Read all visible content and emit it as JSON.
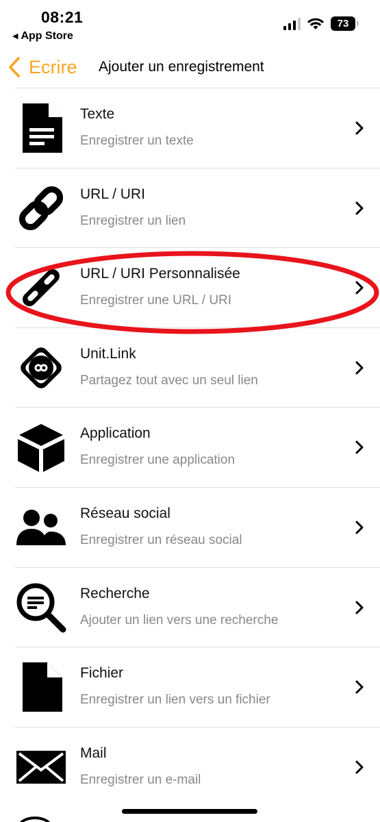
{
  "status_bar": {
    "time": "08:21",
    "back_app": "App Store",
    "battery": "73"
  },
  "nav": {
    "back_label": "Ecrire",
    "title": "Ajouter un enregistrement",
    "accent_color": "#f5a623"
  },
  "items": [
    {
      "icon": "document-icon",
      "title": "Texte",
      "subtitle": "Enregistrer un texte"
    },
    {
      "icon": "link-icon",
      "title": "URL / URI",
      "subtitle": "Enregistrer un lien"
    },
    {
      "icon": "custom-link-icon",
      "title": "URL / URI Personnalisée",
      "subtitle": "Enregistrer une URL / URI"
    },
    {
      "icon": "unitlink-icon",
      "title": "Unit.Link",
      "subtitle": "Partagez tout avec un seul lien"
    },
    {
      "icon": "cube-icon",
      "title": "Application",
      "subtitle": "Enregistrer une application"
    },
    {
      "icon": "people-icon",
      "title": "Réseau social",
      "subtitle": "Enregistrer un réseau social"
    },
    {
      "icon": "search-icon",
      "title": "Recherche",
      "subtitle": "Ajouter un lien vers une recherche"
    },
    {
      "icon": "file-icon",
      "title": "Fichier",
      "subtitle": "Enregistrer un lien vers un fichier"
    },
    {
      "icon": "mail-icon",
      "title": "Mail",
      "subtitle": "Enregistrer un e-mail"
    }
  ],
  "annotation": {
    "color": "#e8141c"
  }
}
